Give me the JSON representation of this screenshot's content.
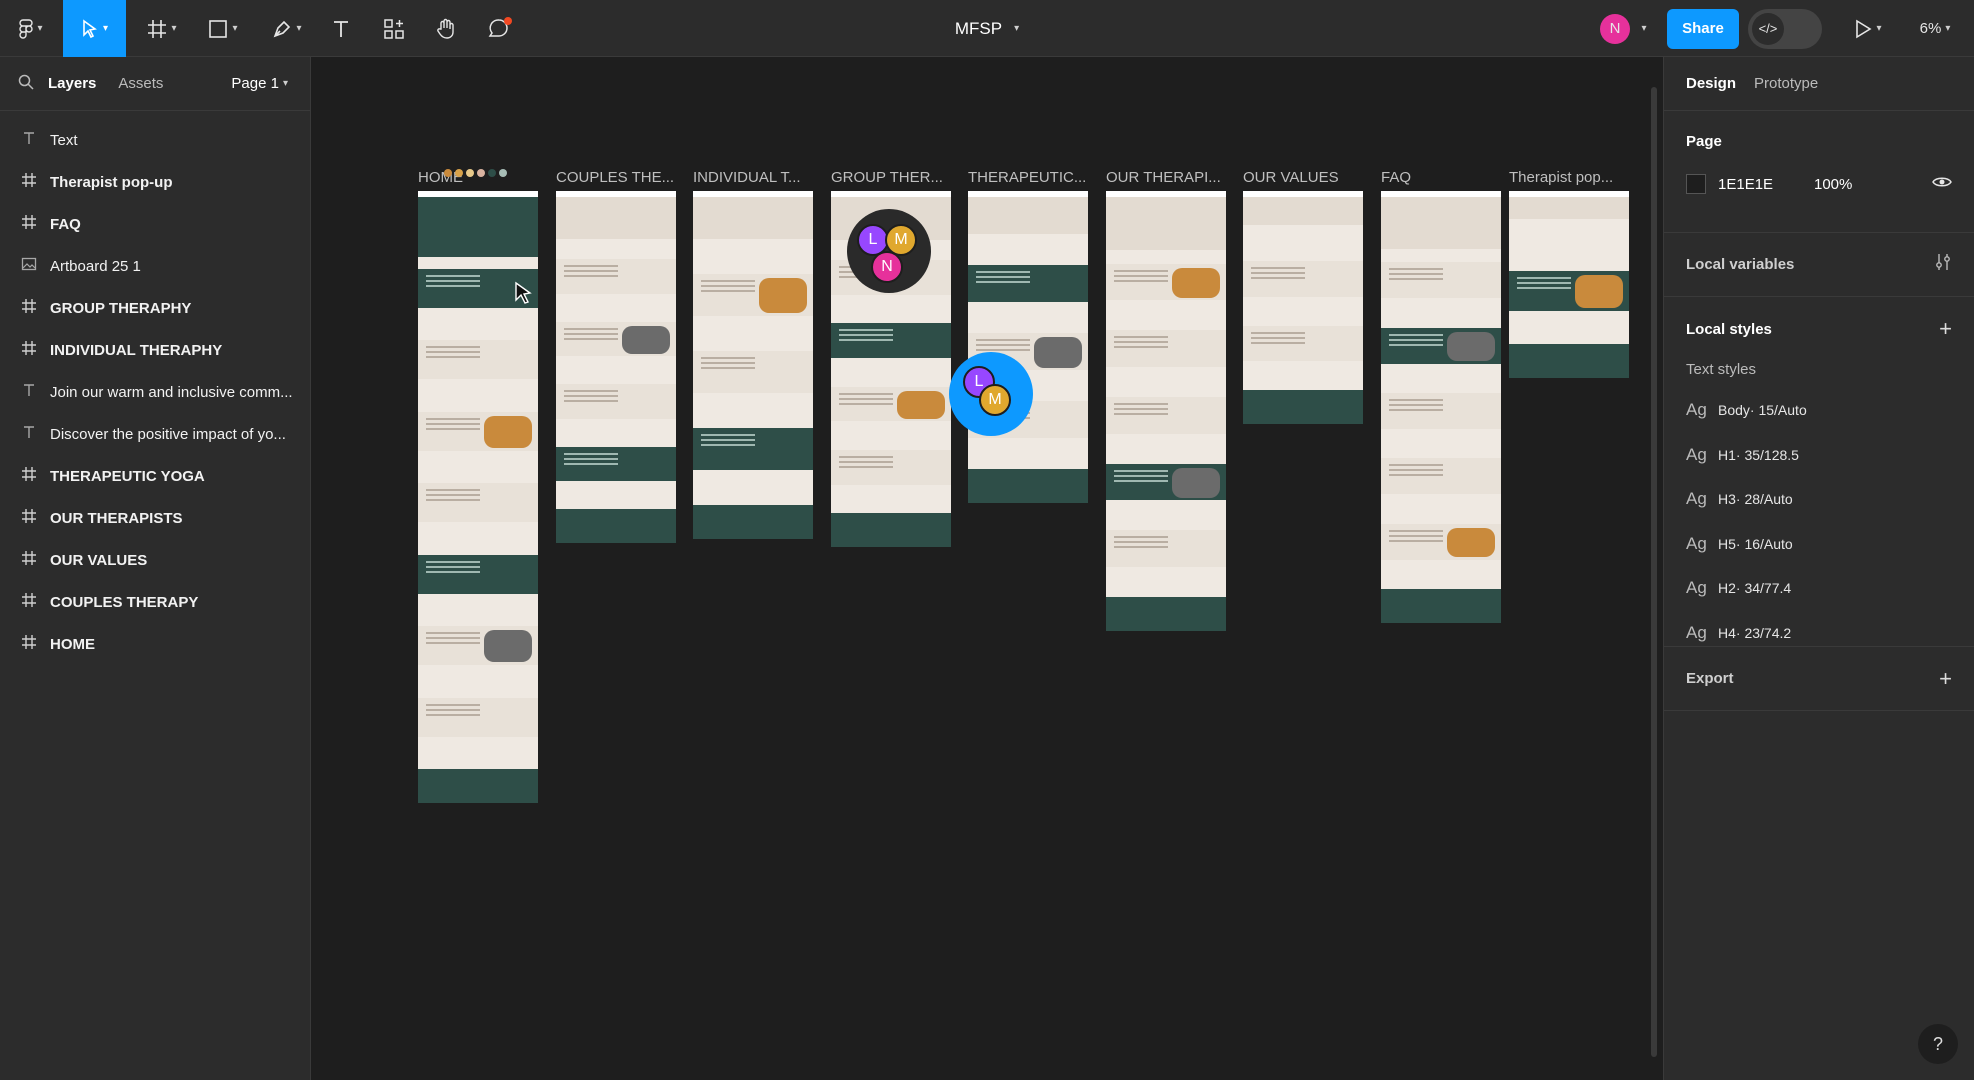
{
  "toolbar": {
    "title": "MFSP",
    "share_label": "Share",
    "zoom": "6%",
    "user_initial": "N",
    "user_color": "#e6319b",
    "share_color": "#0d99ff",
    "tools": [
      "main-menu-icon",
      "move-icon",
      "frame-icon",
      "rectangle-icon",
      "pen-icon",
      "text-icon",
      "components-icon",
      "hand-icon",
      "comment-icon"
    ]
  },
  "left_panel": {
    "tab_layers": "Layers",
    "tab_assets": "Assets",
    "page_select": "Page 1",
    "layers": [
      {
        "label": "Text",
        "icon": "text-icon",
        "frame": false
      },
      {
        "label": "Therapist pop-up",
        "icon": "frame-icon",
        "frame": true
      },
      {
        "label": "FAQ",
        "icon": "frame-icon",
        "frame": true
      },
      {
        "label": "Artboard 25 1",
        "icon": "image-icon",
        "frame": false
      },
      {
        "label": "GROUP THERAPHY",
        "icon": "frame-icon",
        "frame": true
      },
      {
        "label": "INDIVIDUAL THERAPHY",
        "icon": "frame-icon",
        "frame": true
      },
      {
        "label": "Join our warm and inclusive comm...",
        "icon": "text-icon",
        "frame": false
      },
      {
        "label": "Discover the positive impact of yo...",
        "icon": "text-icon",
        "frame": false
      },
      {
        "label": "THERAPEUTIC YOGA",
        "icon": "frame-icon",
        "frame": true
      },
      {
        "label": "OUR THERAPISTS",
        "icon": "frame-icon",
        "frame": true
      },
      {
        "label": "OUR VALUES",
        "icon": "frame-icon",
        "frame": true
      },
      {
        "label": "COUPLES THERAPY",
        "icon": "frame-icon",
        "frame": true
      },
      {
        "label": "HOME",
        "icon": "frame-icon",
        "frame": true
      }
    ]
  },
  "canvas": {
    "artboards": [
      "HOME",
      "COUPLES THE...",
      "INDIVIDUAL T...",
      "GROUP THER...",
      "THERAPEUTIC...",
      "OUR THERAPI...",
      "OUR VALUES",
      "FAQ",
      "Therapist pop..."
    ],
    "collaborators_group1": [
      "L",
      "M",
      "N"
    ],
    "collaborators_group2": [
      "L",
      "M"
    ],
    "colors": {
      "teal": "#2e4e48",
      "cream": "#efe9e2",
      "orange": "#c98a3c",
      "canvas": "#1e1e1e"
    }
  },
  "right_panel": {
    "tab_design": "Design",
    "tab_prototype": "Prototype",
    "page_title": "Page",
    "page_color": "1E1E1E",
    "page_opacity": "100%",
    "local_variables": "Local variables",
    "local_styles": "Local styles",
    "text_styles_title": "Text styles",
    "text_styles": [
      {
        "name": "Body",
        "spec": " · 15/Auto"
      },
      {
        "name": "H1",
        "spec": " · 35/128.5"
      },
      {
        "name": "H3",
        "spec": " · 28/Auto"
      },
      {
        "name": "H5",
        "spec": " · 16/Auto"
      },
      {
        "name": "H2",
        "spec": " · 34/77.4"
      },
      {
        "name": "H4",
        "spec": " · 23/74.2"
      }
    ],
    "export": "Export",
    "help": "?"
  }
}
